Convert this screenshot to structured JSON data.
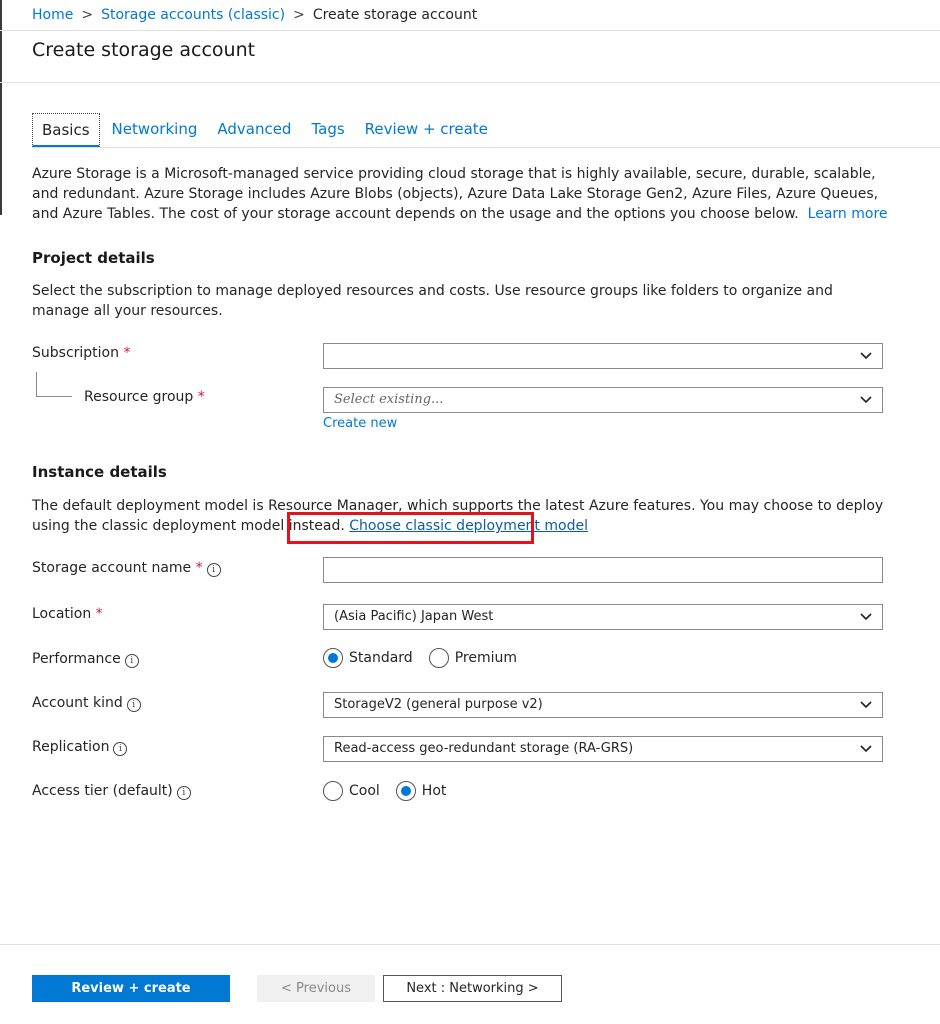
{
  "breadcrumb": {
    "home": "Home",
    "parent": "Storage accounts (classic)",
    "current": "Create storage account",
    "separator": ">"
  },
  "page_title": "Create storage account",
  "tabs": [
    {
      "label": "Basics",
      "active": true
    },
    {
      "label": "Networking",
      "active": false
    },
    {
      "label": "Advanced",
      "active": false
    },
    {
      "label": "Tags",
      "active": false
    },
    {
      "label": "Review + create",
      "active": false
    }
  ],
  "intro": {
    "text": "Azure Storage is a Microsoft-managed service providing cloud storage that is highly available, secure, durable, scalable, and redundant. Azure Storage includes Azure Blobs (objects), Azure Data Lake Storage Gen2, Azure Files, Azure Queues, and Azure Tables. The cost of your storage account depends on the usage and the options you choose below.",
    "learn_more": "Learn more"
  },
  "project_details": {
    "title": "Project details",
    "description": "Select the subscription to manage deployed resources and costs. Use resource groups like folders to organize and manage all your resources.",
    "subscription_label": "Subscription",
    "subscription_value": "",
    "resource_group_label": "Resource group",
    "resource_group_placeholder": "Select existing...",
    "create_new": "Create new"
  },
  "instance_details": {
    "title": "Instance details",
    "description": "The default deployment model is Resource Manager, which supports the latest Azure features. You may choose to deploy using the classic deployment model instead.",
    "classic_link": "Choose classic deployment model",
    "storage_name_label": "Storage account name",
    "storage_name_value": "",
    "location_label": "Location",
    "location_value": "(Asia Pacific) Japan West",
    "performance_label": "Performance",
    "performance_options": [
      "Standard",
      "Premium"
    ],
    "performance_selected": "Standard",
    "account_kind_label": "Account kind",
    "account_kind_value": "StorageV2 (general purpose v2)",
    "replication_label": "Replication",
    "replication_value": "Read-access geo-redundant storage (RA-GRS)",
    "access_tier_label": "Access tier (default)",
    "access_tier_options": [
      "Cool",
      "Hot"
    ],
    "access_tier_selected": "Hot"
  },
  "required_marker": "*",
  "info_glyph": "i",
  "footer": {
    "review_create": "Review + create",
    "previous": "< Previous",
    "next": "Next : Networking >"
  },
  "colors": {
    "accent": "#0078d4",
    "required": "#d1193b",
    "highlight": "#e3131b"
  },
  "icons": {
    "dropdown": "chevron-down-icon",
    "info": "info-icon"
  }
}
